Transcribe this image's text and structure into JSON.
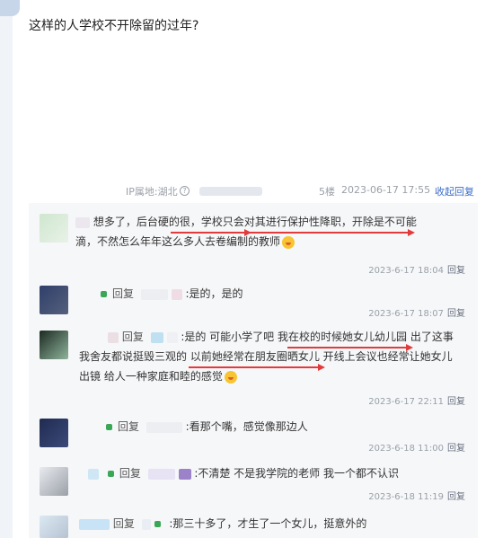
{
  "post": {
    "text": "这样的人学校不开除留的过年?",
    "ip_label": "IP属地:湖北",
    "floor": "5楼",
    "date": "2023-06-17 17:55",
    "collapse_label": "收起回复"
  },
  "replies": [
    {
      "lines": [
        "想多了，后台硬的很，学校只会对其进行保护性降职，开除是不可能",
        "滴，不然怎么年年这么多人去卷编制的教师"
      ],
      "time": "2023-6-17 18:04",
      "reply_label": "回复"
    },
    {
      "prefix": "回复",
      "text": ":是的，是的",
      "time": "2023-6-17 18:07",
      "reply_label": "回复"
    },
    {
      "prefix": "回复",
      "line1_text": ":是的 可能小学了吧 我在校的时候她女儿幼儿园 出了这事",
      "line2": "我舍友都说挺毁三观的 以前她经常在朋友圈晒女儿 开线上会议也经常让她女儿",
      "line3": "出镜 给人一种家庭和睦的感觉",
      "time": "2023-6-17 22:11",
      "reply_label": "回复"
    },
    {
      "prefix": "回复",
      "text": ":看那个嘴，感觉像那边人",
      "time": "2023-6-18 11:00",
      "reply_label": "回复"
    },
    {
      "prefix": "回复",
      "text": ":不清楚 不是我学院的老师 我一个都不认识",
      "time": "2023-6-18 11:19",
      "reply_label": "回复"
    },
    {
      "prefix": "回复",
      "text": ":那三十多了，才生了一个女儿，挺意外的"
    }
  ],
  "colors": {
    "accent": "#3c6ec8",
    "annotation": "#e23b3b"
  }
}
